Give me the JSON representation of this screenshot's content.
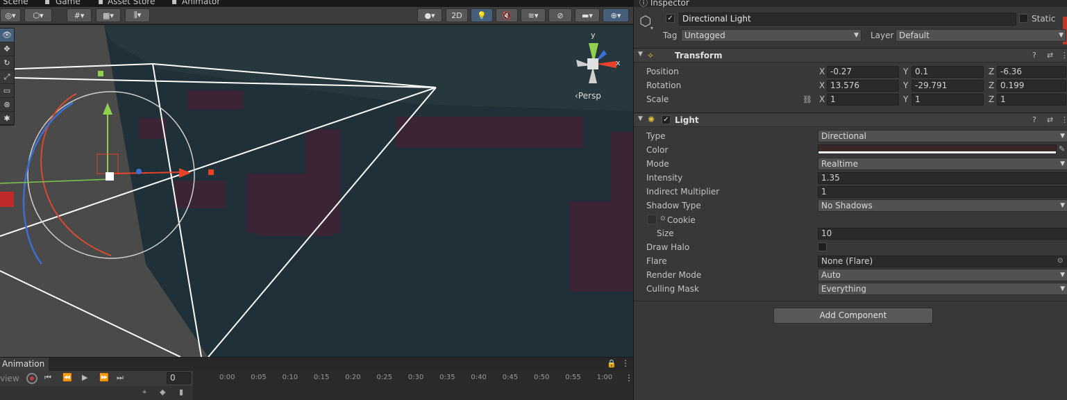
{
  "scene_tabs": {
    "scene": "Scene",
    "game": "Game",
    "asset_store": "Asset Store",
    "animator": "Animator"
  },
  "toolbar": {
    "mode_2d": "2D"
  },
  "viewport": {
    "projection": "Persp",
    "gizmo_y": "y",
    "gizmo_x": "x"
  },
  "animation": {
    "tab_label": "Animation",
    "preview_label": "view",
    "frame_value": "0",
    "ticks": [
      "0:00",
      "0:05",
      "0:10",
      "0:15",
      "0:20",
      "0:25",
      "0:30",
      "0:35",
      "0:40",
      "0:45",
      "0:50",
      "0:55",
      "1:00"
    ]
  },
  "inspector": {
    "tab_label": "Inspector",
    "object_active": true,
    "object_name": "Directional Light",
    "static_label": "Static",
    "tag_label": "Tag",
    "tag_value": "Untagged",
    "layer_label": "Layer",
    "layer_value": "Default",
    "transform": {
      "title": "Transform",
      "position_label": "Position",
      "position": {
        "x": "-0.27",
        "y": "0.1",
        "z": "-6.36"
      },
      "rotation_label": "Rotation",
      "rotation": {
        "x": "13.576",
        "y": "-29.791",
        "z": "0.199"
      },
      "scale_label": "Scale",
      "scale": {
        "x": "1",
        "y": "1",
        "z": "1"
      },
      "axis_x": "X",
      "axis_y": "Y",
      "axis_z": "Z"
    },
    "light": {
      "title": "Light",
      "enabled": true,
      "type_label": "Type",
      "type_value": "Directional",
      "color_label": "Color",
      "color_value": "#3a2626",
      "mode_label": "Mode",
      "mode_value": "Realtime",
      "intensity_label": "Intensity",
      "intensity_value": "1.35",
      "indirect_label": "Indirect Multiplier",
      "indirect_value": "1",
      "shadow_label": "Shadow Type",
      "shadow_value": "No Shadows",
      "cookie_label": "Cookie",
      "size_label": "Size",
      "size_value": "10",
      "halo_label": "Draw Halo",
      "flare_label": "Flare",
      "flare_value": "None (Flare)",
      "render_label": "Render Mode",
      "render_value": "Auto",
      "culling_label": "Culling Mask",
      "culling_value": "Everything"
    },
    "add_component": "Add Component"
  },
  "colors": {
    "accent": "#46607c",
    "inspector_bg": "#383838",
    "viewport_bg": "#1e2c33"
  }
}
